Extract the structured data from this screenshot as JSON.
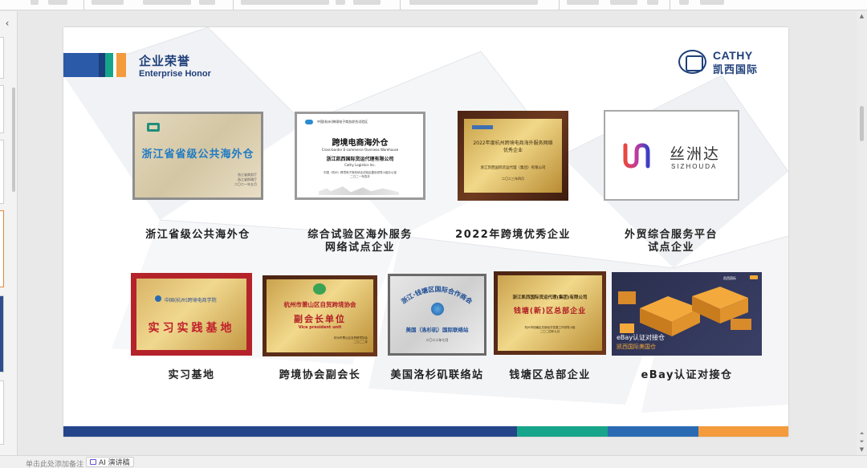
{
  "colors": {
    "brand_blue": "#1e3f7a",
    "brand_mid_blue": "#2a6ab3",
    "brand_green": "#16a58a",
    "brand_orange": "#f39b3d"
  },
  "slide": {
    "title_cn": "企业荣誉",
    "title_en": "Enterprise Honor",
    "logo": {
      "en": "CATHY",
      "cn": "凯西国际"
    }
  },
  "plaques": {
    "p1": {
      "title": "浙江省省级公共海外仓",
      "issuer": "浙江省商务厅\n浙江省财政厅\n二〇二一年五月"
    },
    "p2": {
      "header": "中国(杭州)跨境电子商务综合试验区",
      "title": "跨境电商海外仓",
      "title_en": "Cross-border E-commerce Overseas Warehouse",
      "company": "浙江凯西国际货运代理有限公司",
      "company_en": "Cathy Logistics Inc.",
      "issuer": "中国（杭州）跨境电子商务综合试验区建设领导小组办公室\n二〇二一年四月"
    },
    "p3": {
      "title": "2022年度杭州跨境电商海外服务网络优秀企业",
      "company": "浙江凯西国际货运代理（集团）有限公司",
      "date": "二〇二三年四月"
    },
    "p4": {
      "cn": "丝洲达",
      "en": "SIZHOUDA"
    },
    "p5": {
      "header": "中国(杭州)跨境电商学院",
      "title": "实习实践基地"
    },
    "p6": {
      "header": "杭州市萧山区自贸跨境协会",
      "title": "副会长单位",
      "title_en": "Vice president unit",
      "issuer": "杭州市萧山区自贸跨境协会\n二〇二二年"
    },
    "p7": {
      "arc": "浙江·钱塘区国际合作商会",
      "office": "美国（洛杉矶）国际联络站",
      "date": "二〇二二年七月"
    },
    "p8": {
      "company": "浙江凯西国际货运代理(集团)有限公司",
      "title": "钱塘(新)区总部企业",
      "issuer": "杭州市钱塘区总部经济发展工作领导小组\n二〇二四年九月"
    },
    "p9": {
      "brand": "凯西国际",
      "line1": "eBay认证对接仓",
      "line2": "凯西国际美国仓"
    }
  },
  "captions": {
    "c1": "浙江省级公共海外仓",
    "c2a": "综合试验区海外服务",
    "c2b": "网络试点企业",
    "c3": "2022年跨境优秀企业",
    "c4a": "外贸综合服务平台",
    "c4b": "试点企业",
    "c5": "实习基地",
    "c6": "跨境协会副会长",
    "c7": "美国洛杉矶联络站",
    "c8": "钱塘区总部企业",
    "c9": "eBay认证对接仓"
  },
  "statusbar": {
    "notes_hint": "单击此处添加备注",
    "ai_button": "AI 演讲稿"
  }
}
